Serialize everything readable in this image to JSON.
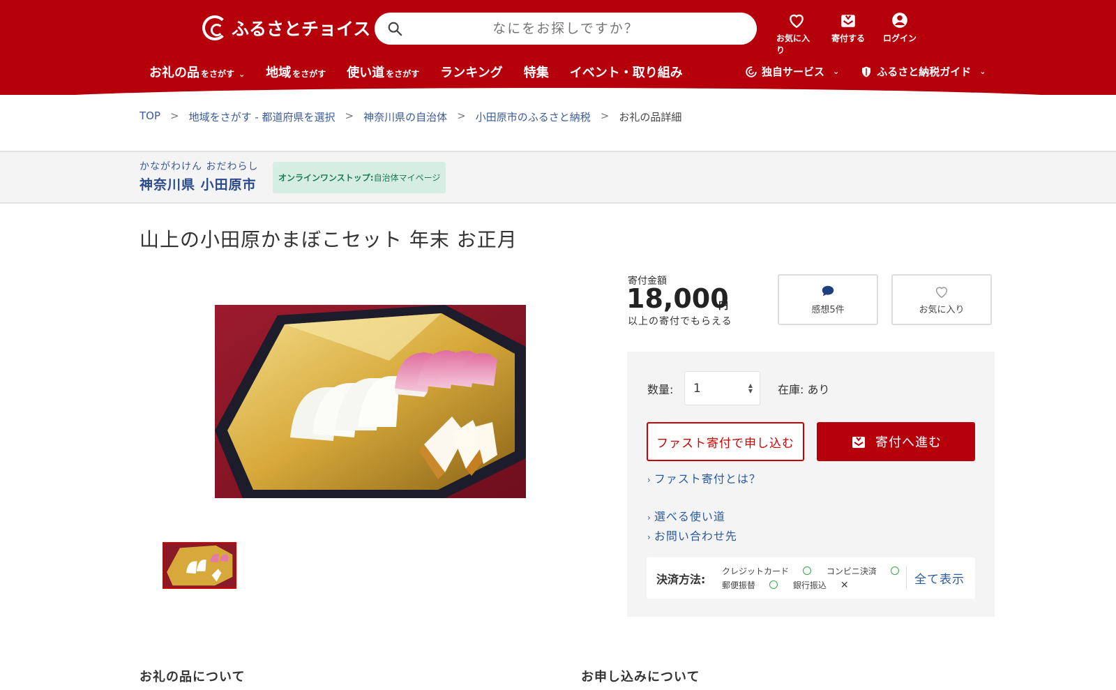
{
  "header": {
    "logo_text": "ふるさとチョイス",
    "search_placeholder": "なにをお探しですか？",
    "icons": [
      {
        "label": "お気に入り",
        "icon": "heart-icon"
      },
      {
        "label": "寄付する",
        "icon": "donate-icon"
      },
      {
        "label": "ログイン",
        "icon": "user-icon"
      }
    ],
    "nav": [
      {
        "main": "お礼の品",
        "small": "をさがす",
        "chevron": "⌄"
      },
      {
        "main": "地域",
        "small": "をさがす"
      },
      {
        "main": "使い道",
        "small": "をさがす"
      },
      {
        "main": "ランキング"
      },
      {
        "main": "特集"
      },
      {
        "main": "イベント・取り組み"
      }
    ],
    "nav_right": [
      {
        "label": "独自サービス",
        "icon": "choice-icon",
        "chevron": "⌄"
      },
      {
        "label": "ふるさと納税ガイド",
        "icon": "shield-icon",
        "chevron": "⌄"
      }
    ],
    "bg_color": "#b5000b"
  },
  "breadcrumb": {
    "items": [
      "TOP",
      "地域をさがす - 都道府県を選択",
      "神奈川県の自治体",
      "小田原市のふるさと納税",
      "お礼の品詳細"
    ],
    "sep": ">"
  },
  "municipality": {
    "kana": "かながわけん おだわらし",
    "name": "神奈川県 小田原市",
    "onestop_bold": "オンラインワンストップ:",
    "onestop_rest": "自治体マイページ"
  },
  "product": {
    "title": "山上の小田原かまぼこセット 年末 お正月",
    "price_label": "寄付金額",
    "price": "18,000",
    "price_unit": "円",
    "price_sub": "以上の寄付でもらえる",
    "review_label": "感想5件",
    "favorite_label": "お気に入り"
  },
  "order": {
    "qty_label": "数量:",
    "qty_value": "1",
    "stock_label": "在庫:",
    "stock_value": "あり",
    "fast_button": "ファスト寄付で申し込む",
    "donate_button": "寄付へ進む",
    "links": [
      "ファスト寄付とは？",
      "選べる使い道",
      "お問い合わせ先"
    ],
    "link_chevron": "›",
    "payment_label": "決済方法:",
    "payments": [
      {
        "name": "クレジットカード",
        "ok": true
      },
      {
        "name": "コンビニ決済",
        "ok": true
      },
      {
        "name": "郵便振替",
        "ok": true
      },
      {
        "name": "銀行振込",
        "ok": false
      }
    ],
    "show_all": "全て表示"
  },
  "sections": [
    "お礼の品について",
    "お申し込みについて"
  ]
}
